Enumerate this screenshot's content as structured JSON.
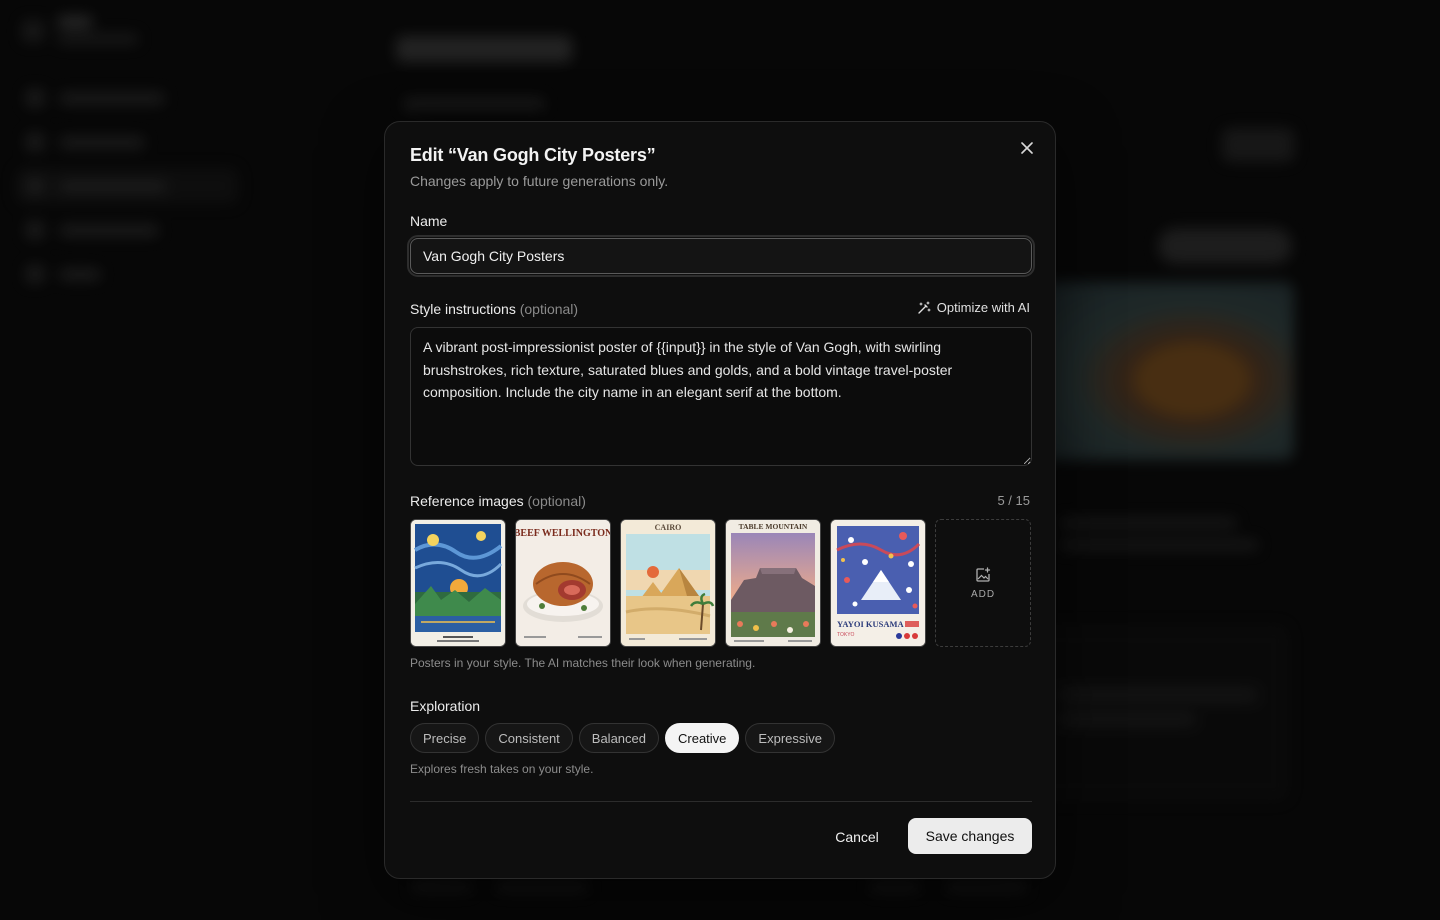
{
  "dialog": {
    "title": "Edit “Van Gogh City Posters”",
    "subtitle": "Changes apply to future generations only.",
    "name_label": "Name",
    "name_value": "Van Gogh City Posters",
    "instructions_label": "Style instructions",
    "instructions_optional": "(optional)",
    "optimize_label": "Optimize with AI",
    "instructions_value": "A vibrant post-impressionist poster of {{input}} in the style of Van Gogh, with swirling brushstrokes, rich texture, saturated blues and golds, and a bold vintage travel-poster composition. Include the city name in an elegant serif at the bottom.",
    "refs_label": "Reference images",
    "refs_optional": "(optional)",
    "refs_count": "5 / 15",
    "refs": [
      {
        "caption": ""
      },
      {
        "caption": "BEEF WELLINGTON"
      },
      {
        "caption": "CAIRO"
      },
      {
        "caption": "TABLE MOUNTAIN"
      },
      {
        "caption": "YAYOI KUSAMA",
        "sub": "TOKYO"
      }
    ],
    "add_label": "ADD",
    "refs_hint": "Posters in your style. The AI matches their look when generating.",
    "exploration_label": "Exploration",
    "exploration_options": [
      "Precise",
      "Consistent",
      "Balanced",
      "Creative",
      "Expressive"
    ],
    "exploration_selected": "Creative",
    "exploration_hint": "Explores fresh takes on your style.",
    "cancel_label": "Cancel",
    "save_label": "Save changes"
  },
  "colors": {
    "background": "#0b0b0b",
    "dialog_bg": "#0e0e0e",
    "selected_chip": "#f4f4f4",
    "primary_button": "#ececec"
  },
  "icons": [
    "close-icon",
    "magic-wand-icon",
    "image-add-icon"
  ]
}
